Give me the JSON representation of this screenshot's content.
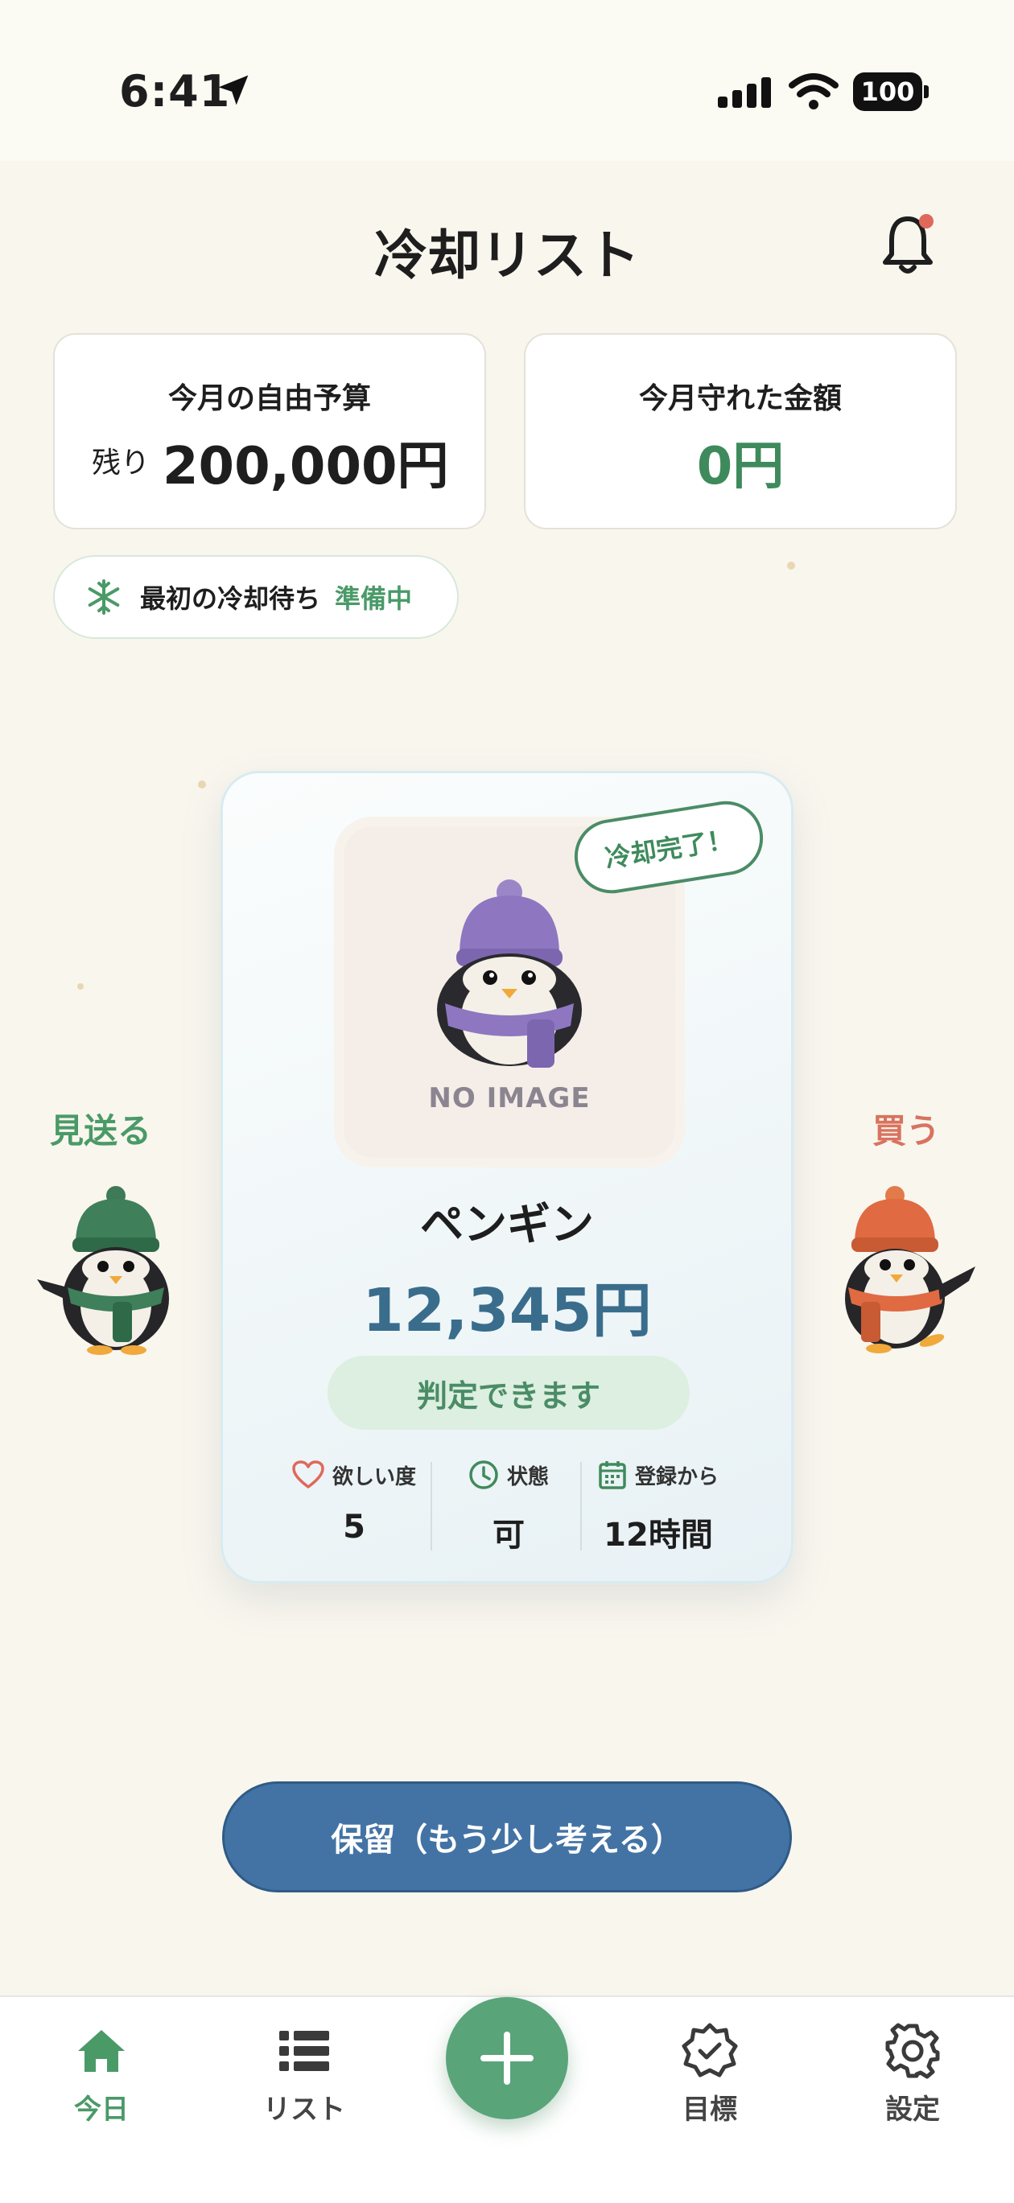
{
  "status_bar": {
    "time": "6:41",
    "battery": "100"
  },
  "header": {
    "title": "冷却リスト"
  },
  "summary": {
    "budget_label": "今月の自由予算",
    "remaining_label": "残り",
    "budget_value": "200,000円",
    "saved_label": "今月守れた金額",
    "saved_value": "0円"
  },
  "cooldown": {
    "label": "最初の冷却待ち",
    "state": "準備中"
  },
  "card": {
    "badge": "冷却完了！",
    "image_placeholder": "NO IMAGE",
    "name": "ペンギン",
    "price": "12,345円",
    "judge_label": "判定できます",
    "stats": [
      {
        "label": "欲しい度",
        "value": "5",
        "icon": "heart-icon"
      },
      {
        "label": "状態",
        "value": "可",
        "icon": "clock-icon"
      },
      {
        "label": "登録から",
        "value": "12時間",
        "icon": "calendar-icon"
      }
    ]
  },
  "swipe": {
    "left_label": "見送る",
    "right_label": "買う"
  },
  "hold_button": "保留（もう少し考える）",
  "tabs": [
    {
      "label": "今日",
      "icon": "home-icon",
      "active": true
    },
    {
      "label": "リスト",
      "icon": "list-icon",
      "active": false
    },
    {
      "label": "目標",
      "icon": "badge-check-icon",
      "active": false
    },
    {
      "label": "設定",
      "icon": "gear-icon",
      "active": false
    }
  ],
  "colors": {
    "accent_green": "#4a9a68",
    "price_blue": "#3a6d8c",
    "hold_blue": "#4373a4",
    "buy_red": "#d8735f"
  }
}
